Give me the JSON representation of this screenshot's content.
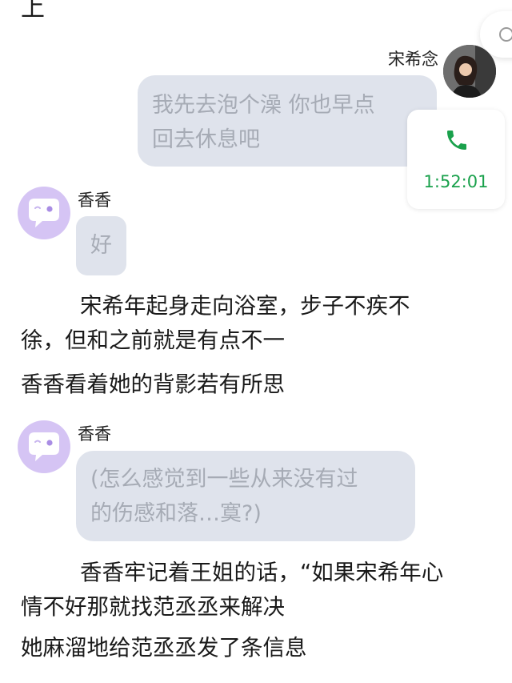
{
  "top_fragment": "上",
  "messages": [
    {
      "sender": "宋希念",
      "side": "right",
      "lines": [
        "我先去泡个澡  你也早点",
        "回去休息吧"
      ]
    },
    {
      "sender": "香香",
      "side": "left",
      "text": "好"
    },
    {
      "sender": "香香",
      "side": "left",
      "lines": [
        "(怎么感觉到一些从来没有过",
        "的伤感和落…寞?)"
      ]
    }
  ],
  "call": {
    "duration": "1:52:01",
    "icon": "phone-icon",
    "color": "#1aa14c"
  },
  "narration": {
    "p1": [
      "宋希年起身走向浴室，步子不疾不",
      "徐，但和之前就是有点不一"
    ],
    "p2": "香香看着她的背影若有所思",
    "p3": [
      "香香牢记着王姐的话，“如果宋希年心",
      "情不好那就找范丞丞来解决"
    ],
    "p4": "她麻溜地给范丞丞发了条信息"
  },
  "colors": {
    "bubble_bg": "#dfe3ec",
    "bubble_text": "#a6abb5",
    "bot_avatar_bg": "#d5c4f4"
  }
}
